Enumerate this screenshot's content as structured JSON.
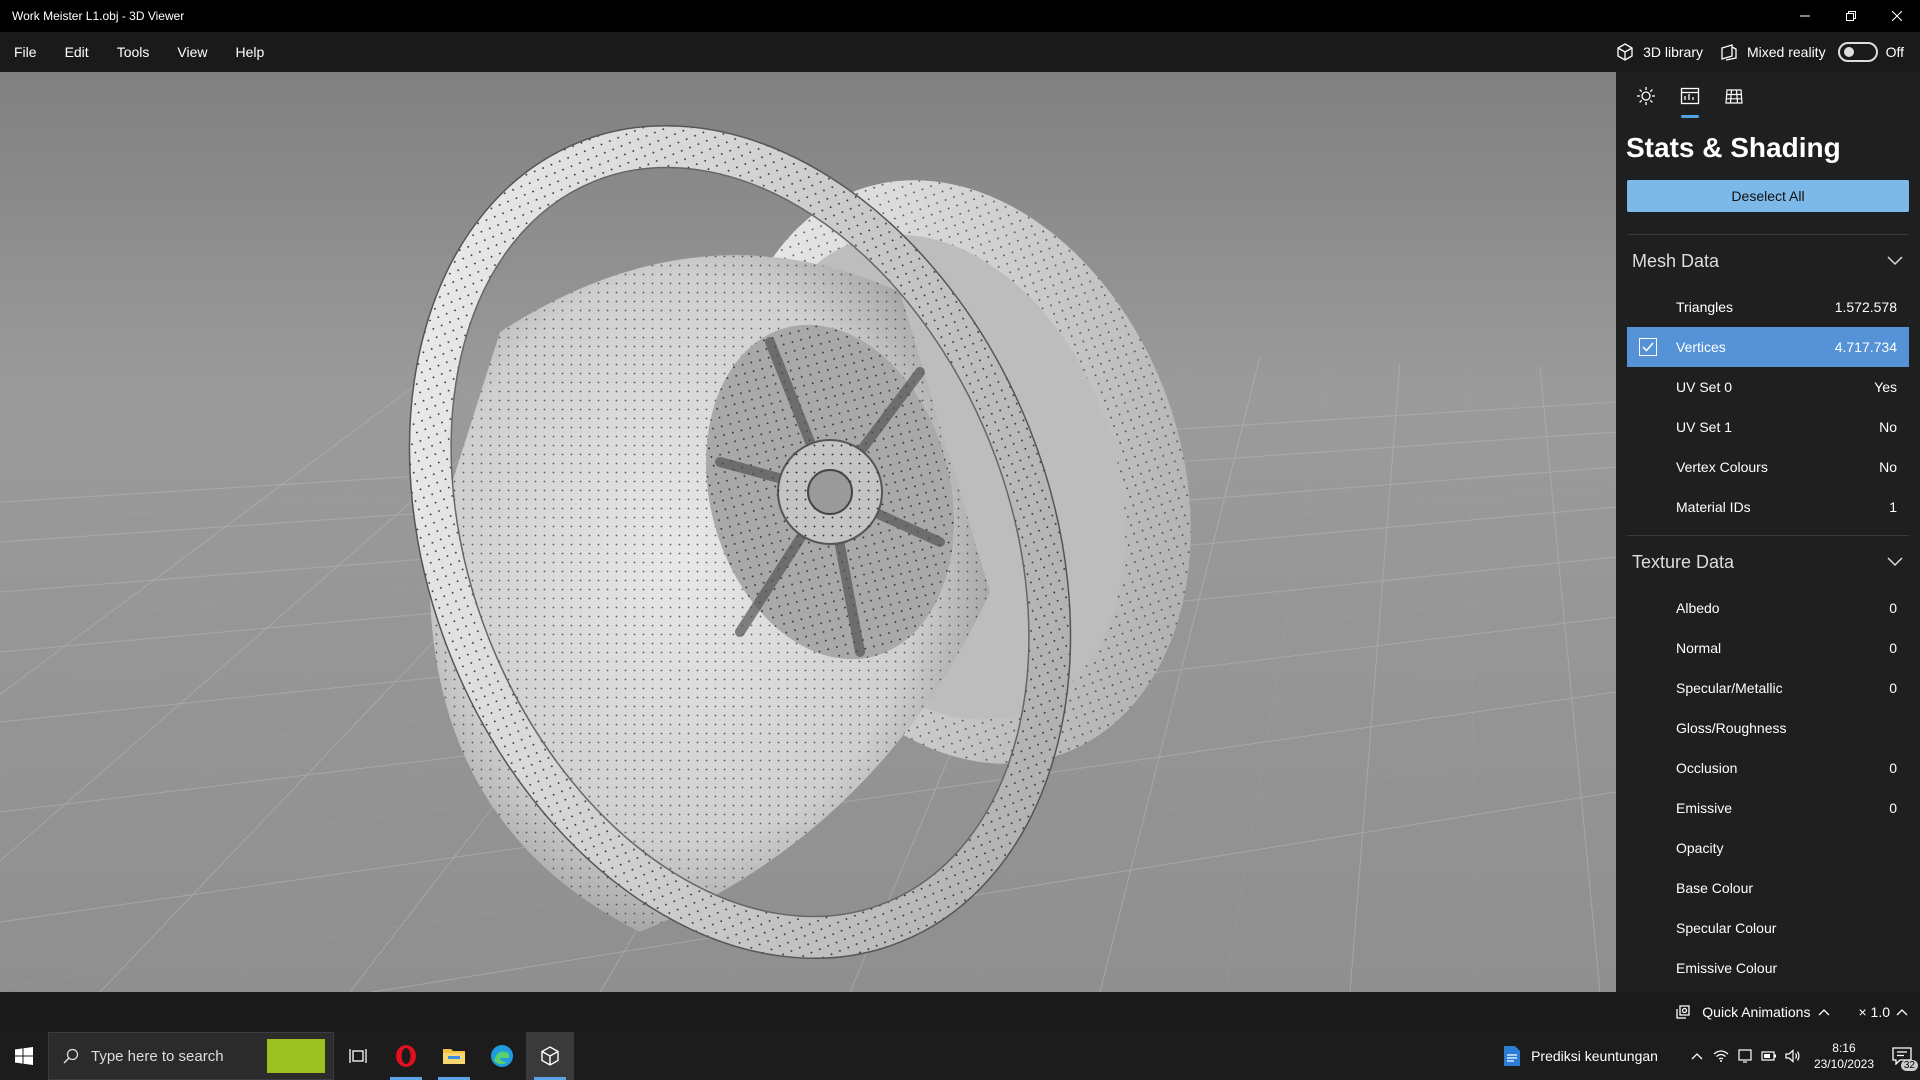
{
  "window": {
    "title": "Work Meister L1.obj - 3D Viewer",
    "controls": [
      "minimize-icon",
      "restore-icon",
      "close-icon"
    ]
  },
  "menu": {
    "items": [
      "File",
      "Edit",
      "Tools",
      "View",
      "Help"
    ],
    "library_label": "3D library",
    "mixed_reality_label": "Mixed reality",
    "mixed_reality_state": "Off"
  },
  "panel": {
    "tabs": [
      "lighting-icon",
      "stats-icon",
      "grid-icon"
    ],
    "title": "Stats & Shading",
    "deselect_label": "Deselect All",
    "mesh_section": "Mesh Data",
    "mesh_rows": [
      {
        "label": "Triangles",
        "value": "1.572.578"
      },
      {
        "label": "Vertices",
        "value": "4.717.734"
      },
      {
        "label": "UV Set 0",
        "value": "Yes"
      },
      {
        "label": "UV Set 1",
        "value": "No"
      },
      {
        "label": "Vertex Colours",
        "value": "No"
      },
      {
        "label": "Material IDs",
        "value": "1"
      }
    ],
    "texture_section": "Texture Data",
    "texture_rows": [
      {
        "label": "Albedo",
        "value": "0"
      },
      {
        "label": "Normal",
        "value": "0"
      },
      {
        "label": "Specular/Metallic",
        "value": "0"
      },
      {
        "label": "Gloss/Roughness",
        "value": ""
      },
      {
        "label": "Occlusion",
        "value": "0"
      },
      {
        "label": "Emissive",
        "value": "0"
      },
      {
        "label": "Opacity",
        "value": ""
      },
      {
        "label": "Base Colour",
        "value": ""
      },
      {
        "label": "Specular Colour",
        "value": ""
      },
      {
        "label": "Emissive Colour",
        "value": ""
      }
    ]
  },
  "status": {
    "quick_animations": "Quick Animations",
    "speed": "× 1.0"
  },
  "taskbar": {
    "search_placeholder": "Type here to search",
    "tray_app": "Prediksi keuntungan",
    "time": "8:16",
    "date": "23/10/2023",
    "notifications": "32"
  },
  "colors": {
    "accent": "#5592d6",
    "button": "#7cb8e8",
    "panel_bg": "#1f1f1f"
  }
}
